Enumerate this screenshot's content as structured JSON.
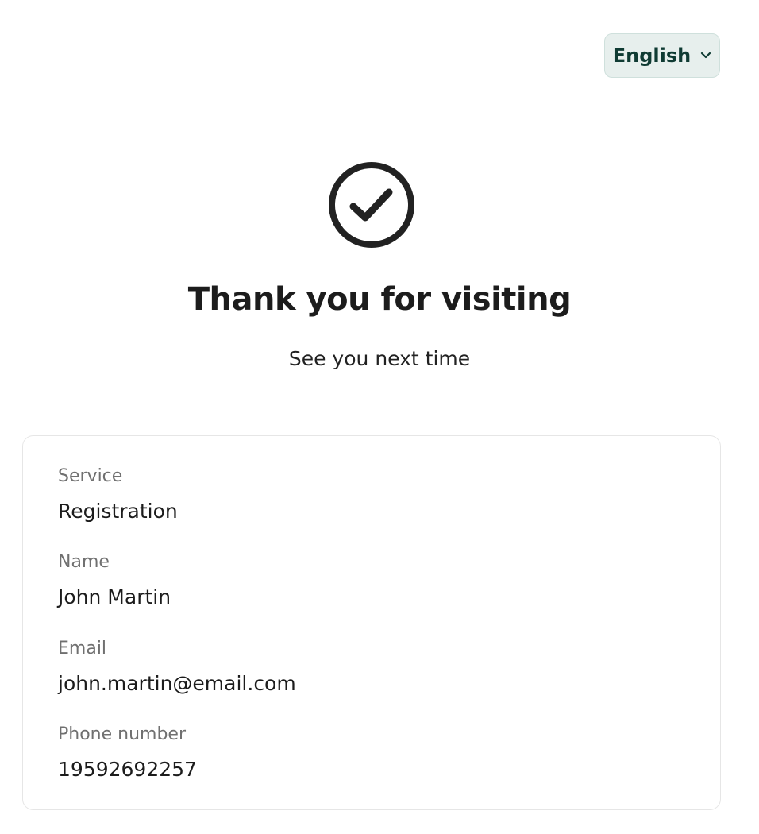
{
  "language": {
    "selected": "English",
    "icon": "chevron-down-icon"
  },
  "status": {
    "icon": "check-circle-icon",
    "title": "Thank you for visiting",
    "subtitle": "See you next time"
  },
  "details": [
    {
      "label": "Service",
      "value": "Registration"
    },
    {
      "label": "Name",
      "value": "John Martin"
    },
    {
      "label": "Email",
      "value": "john.martin@email.com"
    },
    {
      "label": "Phone number",
      "value": "19592692257"
    }
  ],
  "colors": {
    "language_button_bg": "#e7efed",
    "language_button_text": "#0f3b33",
    "label_text": "#707070"
  }
}
